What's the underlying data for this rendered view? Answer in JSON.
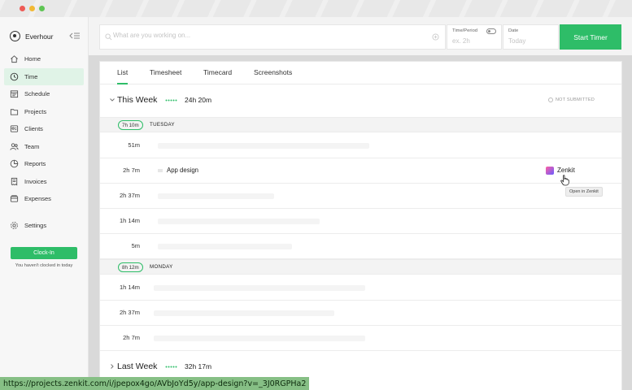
{
  "app": {
    "name": "Everhour"
  },
  "nav": {
    "items": [
      {
        "label": "Home",
        "icon": "home-icon"
      },
      {
        "label": "Time",
        "icon": "clock-icon",
        "active": true
      },
      {
        "label": "Schedule",
        "icon": "schedule-icon"
      },
      {
        "label": "Projects",
        "icon": "projects-icon"
      },
      {
        "label": "Clients",
        "icon": "clients-icon"
      },
      {
        "label": "Team",
        "icon": "team-icon"
      },
      {
        "label": "Reports",
        "icon": "reports-icon"
      },
      {
        "label": "Invoices",
        "icon": "invoices-icon"
      },
      {
        "label": "Expenses",
        "icon": "expenses-icon"
      }
    ],
    "settings": "Settings"
  },
  "clock": {
    "button": "Clock-In",
    "note": "You haven't clocked in today"
  },
  "timer": {
    "placeholder": "What are you working on...",
    "period_label": "Time/Period",
    "period_placeholder": "ex. 2h",
    "date_label": "Date",
    "date_placeholder": "Today",
    "start": "Start Timer"
  },
  "tabs": [
    "List",
    "Timesheet",
    "Timecard",
    "Screenshots"
  ],
  "this_week": {
    "title": "This Week",
    "total": "24h 20m",
    "status": "NOT SUBMITTED",
    "days": [
      {
        "badge": "7h 10m",
        "name": "TUESDAY",
        "rows": [
          {
            "dur": "51m"
          },
          {
            "dur": "2h 7m",
            "task": "App design",
            "integration": "Zenkit",
            "tooltip": "Open in Zenkit"
          },
          {
            "dur": "2h 37m"
          },
          {
            "dur": "1h 14m"
          },
          {
            "dur": "5m"
          }
        ]
      },
      {
        "badge": "8h 12m",
        "name": "MONDAY",
        "rows": [
          {
            "dur": "1h 14m"
          },
          {
            "dur": "2h 37m"
          },
          {
            "dur": "2h 7m"
          }
        ]
      }
    ]
  },
  "last_week": {
    "title": "Last Week",
    "total": "32h 17m"
  },
  "status_url": "https://projects.zenkit.com/i/jpepox4go/AVbJoYd5y/app-design?v=_3J0RGPHa2",
  "colors": {
    "accent": "#2ebd68",
    "active_bg": "#e0f3e7"
  }
}
